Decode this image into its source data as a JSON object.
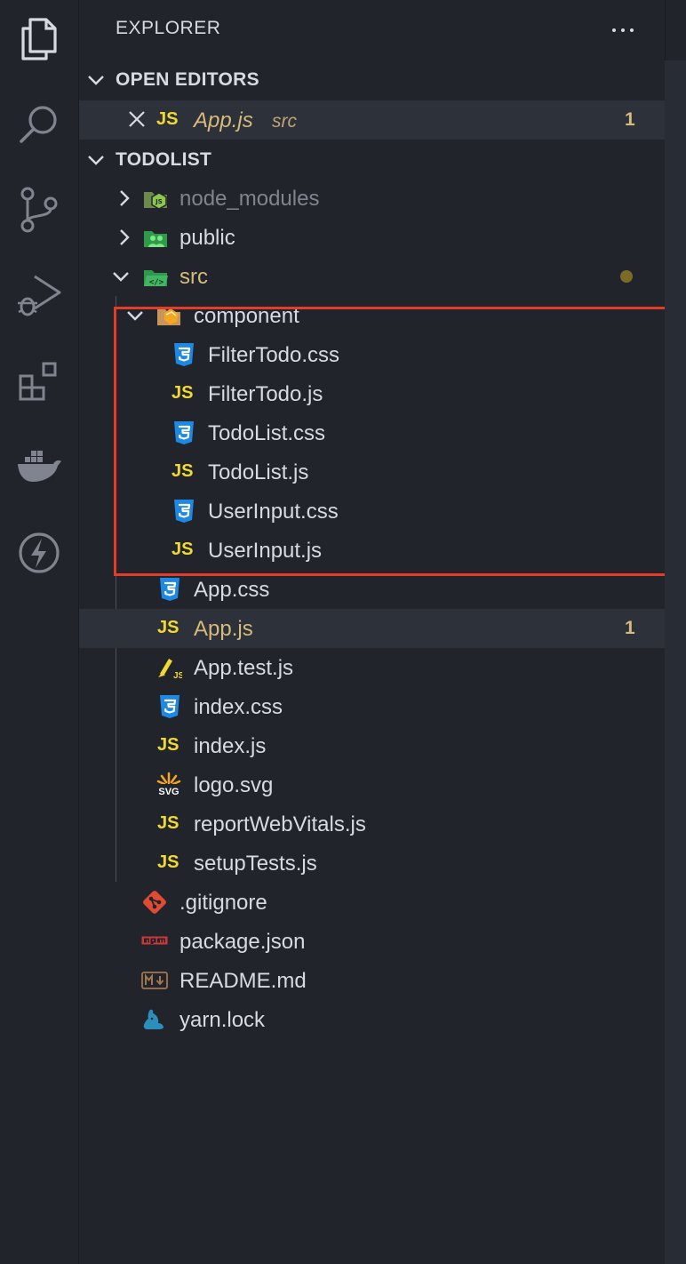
{
  "explorer": {
    "title": "EXPLORER"
  },
  "open_editors": {
    "label": "OPEN EDITORS",
    "items": [
      {
        "name": "App.js",
        "path": "src",
        "badge": "1",
        "icon": "js-icon"
      }
    ]
  },
  "workspace": {
    "label": "TODOLIST",
    "folders": {
      "node_modules": "node_modules",
      "public": "public",
      "src": "src",
      "component": "component"
    },
    "component_files": [
      {
        "name": "FilterTodo.css",
        "icon": "css-icon"
      },
      {
        "name": "FilterTodo.js",
        "icon": "js-icon"
      },
      {
        "name": "TodoList.css",
        "icon": "css-icon"
      },
      {
        "name": "TodoList.js",
        "icon": "js-icon"
      },
      {
        "name": "UserInput.css",
        "icon": "css-icon"
      },
      {
        "name": "UserInput.js",
        "icon": "js-icon"
      }
    ],
    "src_files": [
      {
        "name": "App.css",
        "icon": "css-icon"
      },
      {
        "name": "App.js",
        "icon": "js-icon",
        "badge": "1"
      },
      {
        "name": "App.test.js",
        "icon": "test-js-icon"
      },
      {
        "name": "index.css",
        "icon": "css-icon"
      },
      {
        "name": "index.js",
        "icon": "js-icon"
      },
      {
        "name": "logo.svg",
        "icon": "svg-icon"
      },
      {
        "name": "reportWebVitals.js",
        "icon": "js-icon"
      },
      {
        "name": "setupTests.js",
        "icon": "js-icon"
      }
    ],
    "root_files": [
      {
        "name": ".gitignore",
        "icon": "git-icon"
      },
      {
        "name": "package.json",
        "icon": "npm-icon"
      },
      {
        "name": "README.md",
        "icon": "markdown-icon"
      },
      {
        "name": "yarn.lock",
        "icon": "yarn-icon"
      }
    ]
  },
  "js_glyph": "JS",
  "svg_glyph": "SVG",
  "colors": {
    "background": "#21252b",
    "text": "#d7dae0",
    "modified": "#d7ba7d",
    "js_yellow": "#f1d934",
    "css_blue": "#1e88e5",
    "highlight_red": "#e53c2a"
  }
}
